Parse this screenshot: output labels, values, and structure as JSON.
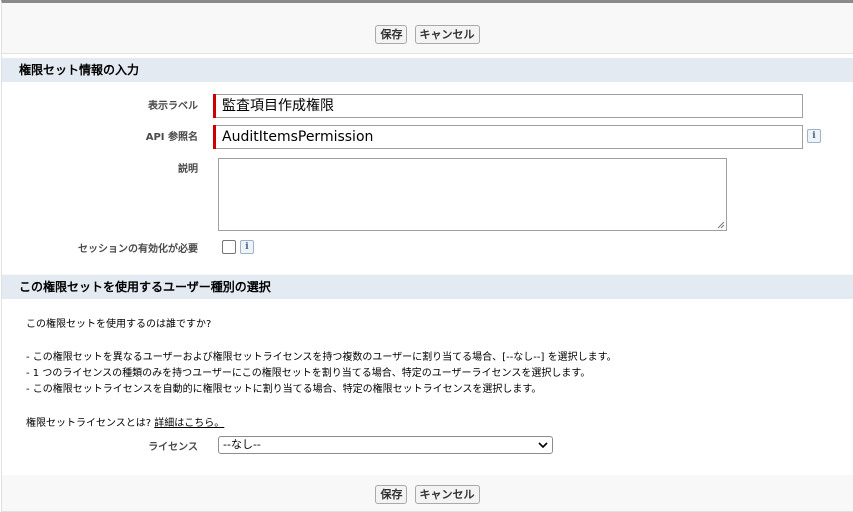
{
  "buttons": {
    "save": "保存",
    "cancel": "キャンセル"
  },
  "section1": {
    "title": "権限セット情報の入力",
    "fields": {
      "label": {
        "label": "表示ラベル",
        "value": "監査項目作成権限"
      },
      "api_name": {
        "label": "API 参照名",
        "value": "AuditItemsPermission"
      },
      "description": {
        "label": "説明",
        "value": ""
      },
      "session": {
        "label": "セッションの有効化が必要",
        "checked": false
      }
    },
    "info_icon": "i"
  },
  "section2": {
    "title": "この権限セットを使用するユーザー種別の選択",
    "question": "この権限セットを使用するのは誰ですか?",
    "bullets": [
      "- この権限セットを異なるユーザーおよび権限セットライセンスを持つ複数のユーザーに割り当てる場合、[--なし--] を選択します。",
      "- 1 つのライセンスの種類のみを持つユーザーにこの権限セットを割り当てる場合、特定のユーザーライセンスを選択します。",
      "- この権限セットライセンスを自動的に権限セットに割り当てる場合、特定の権限セットライセンスを選択します。"
    ],
    "license_question": "権限セットライセンスとは?",
    "details_link": "詳細はこちら。",
    "license_label": "ライセンス",
    "license_value": "--なし--"
  }
}
